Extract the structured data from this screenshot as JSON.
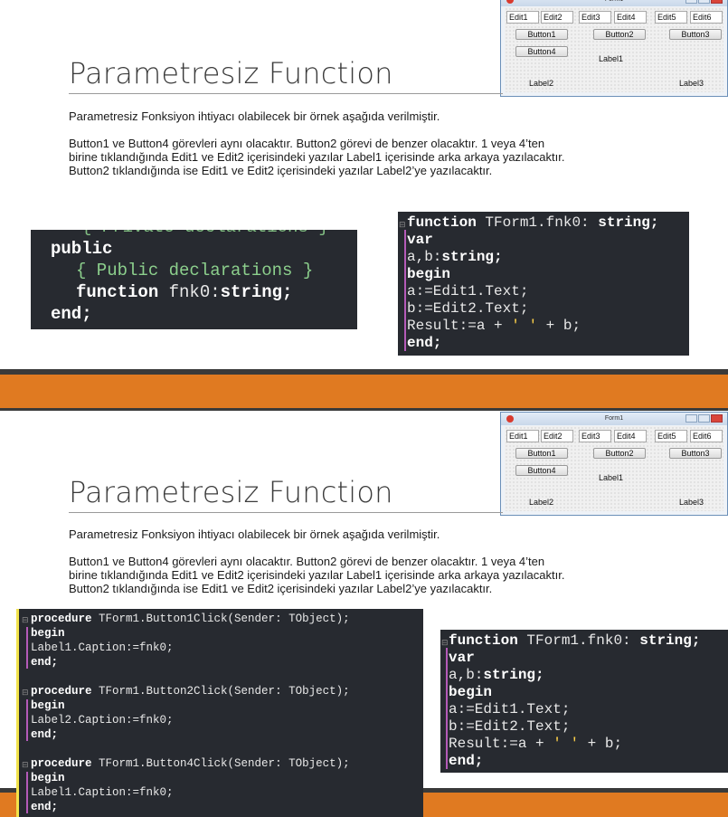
{
  "slides": [
    {
      "title": "Parametresiz Function",
      "intro": "Parametresiz Fonksiyon ihtiyacı olabilecek bir örnek aşağıda verilmiştir.",
      "paragraph": [
        "Button1 ve Button4 görevleri aynı olacaktır. Button2 görevi de benzer olacaktır. 1 veya 4’ten",
        "birine tıklandığında Edit1 ve Edit2 içerisindeki yazılar Label1 içerisinde arka arkaya yazılacaktır.",
        "Button2 tıklandığında ise Edit1 ve Edit2 içerisindeki yazılar Label2’ye yazılacaktır."
      ],
      "decl_code": {
        "partial": "{ Private declarations }",
        "public": "public",
        "comment": "{ Public declarations }",
        "function_kw": "function",
        "function_name": "fnk0:",
        "function_type": "string;",
        "end": "end;"
      }
    },
    {
      "title": "Parametresiz Function",
      "intro": "Parametresiz Fonksiyon ihtiyacı olabilecek bir örnek aşağıda verilmiştir.",
      "paragraph": [
        "Button1 ve Button4 görevleri aynı olacaktır. Button2 görevi de benzer olacaktır. 1 veya 4’ten",
        "birine tıklandığında Edit1 ve Edit2 içerisindeki yazılar Label1 içerisinde arka arkaya yazılacaktır.",
        "Button2 tıklandığında ise Edit1 ve Edit2 içerisindeki yazılar Label2’ye yazılacaktır."
      ],
      "procedures": [
        {
          "kw": "procedure",
          "sig": "TForm1.Button1Click(Sender: TObject);",
          "begin": "begin",
          "body": "Label1.Caption:=fnk0;",
          "end": "end;"
        },
        {
          "kw": "procedure",
          "sig": "TForm1.Button2Click(Sender: TObject);",
          "begin": "begin",
          "body": "Label2.Caption:=fnk0;",
          "end": "end;"
        },
        {
          "kw": "procedure",
          "sig": "TForm1.Button4Click(Sender: TObject);",
          "begin": "begin",
          "body": "Label1.Caption:=fnk0;",
          "end": "end;"
        }
      ]
    }
  ],
  "func_code": {
    "kw": "function",
    "name": "TForm1.fnk0:",
    "type": "string;",
    "var": "var",
    "vars": "a,b:",
    "vars_type": "string;",
    "begin": "begin",
    "line1": "a:=Edit1.Text;",
    "line2": "b:=Edit2.Text;",
    "result_a": "Result:=a +",
    "quote": "' '",
    "result_b": "+ b;",
    "end": "end;"
  },
  "form_window": {
    "title": "Form1",
    "edits": [
      "Edit1",
      "Edit2",
      "Edit3",
      "Edit4",
      "Edit5",
      "Edit6"
    ],
    "buttons": [
      "Button1",
      "Button2",
      "Button3",
      "Button4"
    ],
    "labels": [
      "Label1",
      "Label2",
      "Label3"
    ]
  },
  "colors": {
    "accent_orange": "#e07a21",
    "band_dark": "#3a3a3a",
    "code_bg": "#272a30"
  }
}
